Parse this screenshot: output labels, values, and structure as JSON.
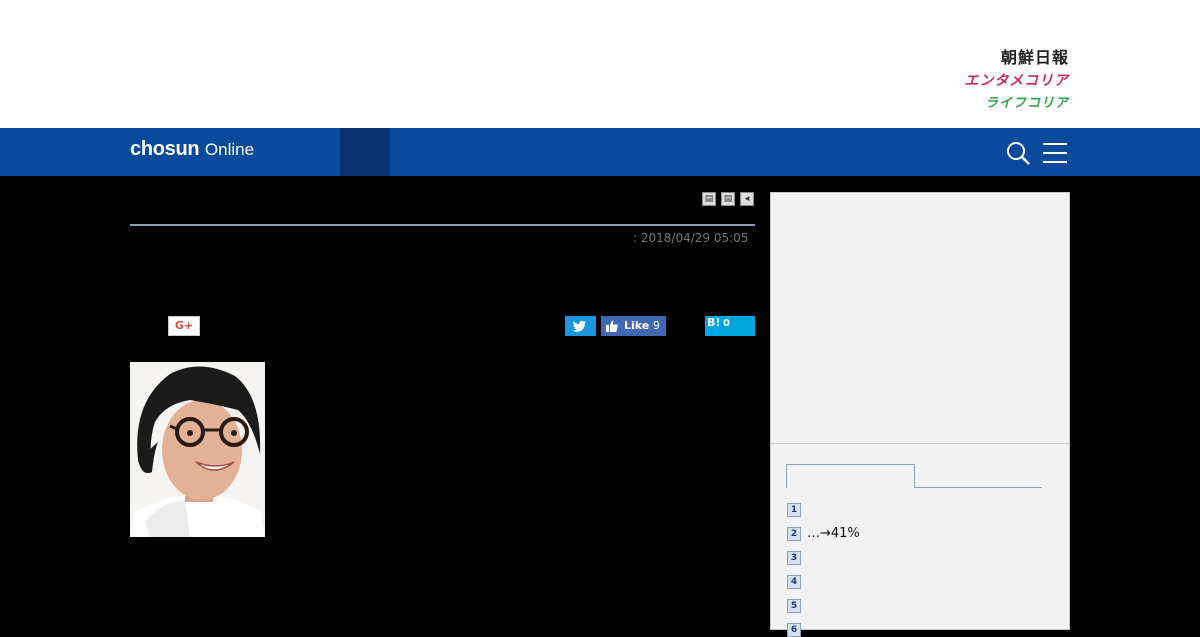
{
  "header": {
    "brands": [
      "朝鮮日報",
      "エンタメコリア",
      "ライフコリア"
    ]
  },
  "nav": {
    "logo_bold": "chosun",
    "logo_light": "Online",
    "search_icon": "search-icon",
    "menu_icon": "hamburger-menu-icon"
  },
  "colors": {
    "nav_bg": "#0a4a9c",
    "nav_active": "#06336f",
    "twitter": "#1b95e0",
    "facebook": "#4267b2",
    "hatena": "#00a4de",
    "sidebar_bg": "#f2f2f2"
  },
  "article": {
    "date": ": 2018/04/29 05:05",
    "tools": [
      "print-icon",
      "list-icon",
      "back-icon"
    ]
  },
  "share": {
    "gplus_label": "G+",
    "facebook_label": "Like",
    "facebook_count": "9",
    "hatena_label": "B!",
    "hatena_count": "0"
  },
  "ranking": {
    "items": [
      {
        "rank": "1",
        "text": ""
      },
      {
        "rank": "2",
        "text": "…→41%"
      },
      {
        "rank": "3",
        "text": ""
      },
      {
        "rank": "4",
        "text": ""
      },
      {
        "rank": "5",
        "text": ""
      },
      {
        "rank": "6",
        "text": ""
      }
    ]
  }
}
